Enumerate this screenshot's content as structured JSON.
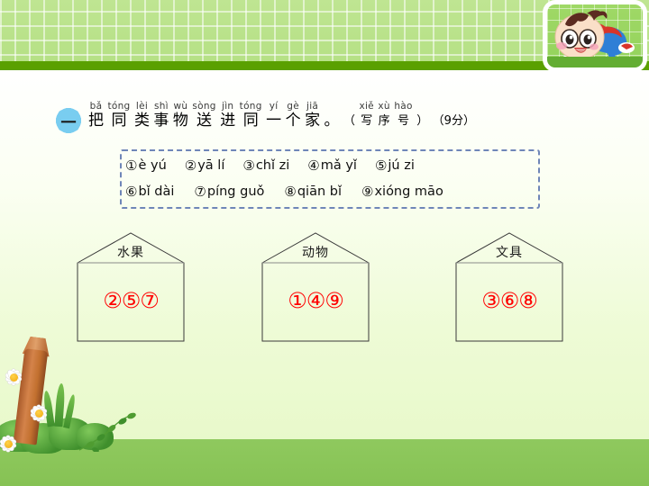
{
  "header": {
    "mascot": "crawling-baby-mascot"
  },
  "question": {
    "number": "一",
    "ruby": [
      {
        "py": "bǎ",
        "hz": "把"
      },
      {
        "py": "tóng",
        "hz": "同"
      },
      {
        "py": "lèi",
        "hz": "类"
      },
      {
        "py": "shì",
        "hz": "事"
      },
      {
        "py": "wù",
        "hz": "物"
      },
      {
        "py": "sòng",
        "hz": "送"
      },
      {
        "py": "jìn",
        "hz": "进"
      },
      {
        "py": "tóng",
        "hz": "同"
      },
      {
        "py": "yí",
        "hz": "一"
      },
      {
        "py": "gè",
        "hz": "个"
      },
      {
        "py": "jiā",
        "hz": "家"
      }
    ],
    "period": "。",
    "note_ruby": [
      {
        "py": "xiě",
        "hz": "写"
      },
      {
        "py": "xù",
        "hz": "序"
      },
      {
        "py": "hào",
        "hz": "号"
      }
    ],
    "note_open": "（",
    "note_close": "）",
    "score": "（9分）"
  },
  "wordbox": {
    "row1": [
      {
        "num": "①",
        "word": "è yú"
      },
      {
        "num": "②",
        "word": "yā lí"
      },
      {
        "num": "③",
        "word": "chǐ zi"
      },
      {
        "num": "④",
        "word": "mǎ yǐ"
      },
      {
        "num": "⑤",
        "word": "jú zi"
      }
    ],
    "row2": [
      {
        "num": "⑥",
        "word": "bǐ dài"
      },
      {
        "num": "⑦",
        "word": "píng guǒ"
      },
      {
        "num": "⑧",
        "word": "qiān bǐ"
      },
      {
        "num": "⑨",
        "word": "xióng māo"
      }
    ]
  },
  "houses": [
    {
      "label": "水果",
      "answer": "②⑤⑦"
    },
    {
      "label": "动物",
      "answer": "①④⑨"
    },
    {
      "label": "文具",
      "answer": "③⑥⑧"
    }
  ],
  "colors": {
    "header_grid": "#b4e083",
    "header_bar": "#5aa000",
    "ground": "#8fc95e",
    "answer_red": "#ff0000",
    "flower_blue": "#79cdf0",
    "dash_border": "#6f86b8"
  }
}
